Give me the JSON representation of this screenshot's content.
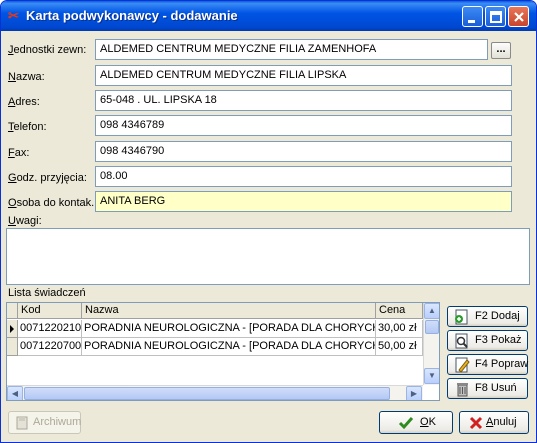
{
  "window": {
    "title": "Karta podwykonawcy - dodawanie"
  },
  "form": {
    "jednostki": {
      "label_ul": "J",
      "label_rest": "ednostki zewn:",
      "value": "ALDEMED CENTRUM MEDYCZNE FILIA ZAMENHOFA",
      "button": "..."
    },
    "nazwa": {
      "label_ul": "N",
      "label_rest": "azwa:",
      "value": "ALDEMED CENTRUM MEDYCZNE FILIA LIPSKA"
    },
    "adres": {
      "label_ul": "A",
      "label_rest": "dres:",
      "value": "65-048 . UL. LIPSKA 18"
    },
    "telefon": {
      "label_ul": "T",
      "label_rest": "elefon:",
      "value": "098 4346789"
    },
    "fax": {
      "label_ul": "F",
      "label_rest": "ax:",
      "value": "098 4346790"
    },
    "godz": {
      "label_ul": "G",
      "label_rest": "odz. przyjęcia:",
      "value": "08.00"
    },
    "osoba": {
      "label_ul": "O",
      "label_rest": "soba do kontak.:",
      "value": "ANITA BERG"
    },
    "uwagi": {
      "label_ul": "U",
      "label_rest": "wagi:",
      "value": ""
    }
  },
  "lista": {
    "label": "Lista świadczeń",
    "columns": [
      "Kod",
      "Nazwa",
      "Cena"
    ],
    "rows": [
      {
        "kod": "0071220210",
        "nazwa": "PORADNIA NEUROLOGICZNA - [PORADA DLA CHORYCH Z",
        "cena": "30,00 zł"
      },
      {
        "kod": "0071220700",
        "nazwa": "PORADNIA NEUROLOGICZNA - [PORADA DLA CHORYCH Z",
        "cena": "50,00 zł"
      }
    ]
  },
  "side_buttons": {
    "dodaj": "F2 Dodaj",
    "pokaz": "F3 Pokaż",
    "popraw": "F4 Popraw",
    "usun": "F8 Usuń"
  },
  "bottom_buttons": {
    "archiwum": "Archiwum",
    "ok_ul": "O",
    "ok_rest": "K",
    "anuluj_ul": "A",
    "anuluj_rest": "nuluj"
  },
  "colors": {
    "titlebar": "#0055e5",
    "highlight_field": "#ffffc8",
    "window_bg": "#ece9d8"
  }
}
